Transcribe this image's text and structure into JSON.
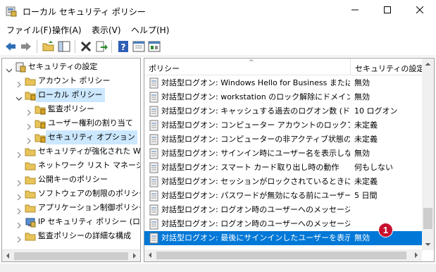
{
  "window": {
    "title": "ローカル セキュリティ ポリシー",
    "icon": "security-policy-icon",
    "controls": [
      "minimize-icon",
      "maximize-icon",
      "close-icon"
    ]
  },
  "menu": [
    {
      "label": "ファイル(F)"
    },
    {
      "label": "操作(A)"
    },
    {
      "label": "表示(V)"
    },
    {
      "label": "ヘルプ(H)"
    }
  ],
  "toolbar": [
    "back-arrow-icon",
    "forward-arrow-icon",
    "up-folder-icon",
    "show-hide-tree-icon",
    "delete-icon",
    "export-icon",
    "help-icon",
    "view-icon",
    "refresh-icon"
  ],
  "tree": [
    {
      "label": "セキュリティの設定",
      "level": 0,
      "expanded": true,
      "icon": "security-settings-icon"
    },
    {
      "label": "アカウント ポリシー",
      "level": 1,
      "expanded": false,
      "icon": "folder-icon"
    },
    {
      "label": "ローカル ポリシー",
      "level": 1,
      "expanded": true,
      "icon": "folder-open-icon",
      "selected": true
    },
    {
      "label": "監査ポリシー",
      "level": 2,
      "expanded": false,
      "icon": "folder-icon"
    },
    {
      "label": "ユーザー権利の割り当て",
      "level": 2,
      "expanded": false,
      "icon": "folder-icon"
    },
    {
      "label": "セキュリティ オプション",
      "level": 2,
      "expanded": false,
      "icon": "folder-icon",
      "highlight": true
    },
    {
      "label": "セキュリティが強化された Windo",
      "level": 1,
      "expanded": false,
      "icon": "folder-icon"
    },
    {
      "label": "ネットワーク リスト マネージャー ポ",
      "level": 1,
      "expanded": null,
      "icon": "folder-icon"
    },
    {
      "label": "公開キーのポリシー",
      "level": 1,
      "expanded": false,
      "icon": "folder-icon"
    },
    {
      "label": "ソフトウェアの制限のポリシー",
      "level": 1,
      "expanded": false,
      "icon": "folder-icon"
    },
    {
      "label": "アプリケーション制御ポリシー",
      "level": 1,
      "expanded": false,
      "icon": "folder-icon"
    },
    {
      "label": "IP セキュリティ ポリシー (ローカル :",
      "level": 1,
      "expanded": false,
      "icon": "ip-security-icon"
    },
    {
      "label": "監査ポリシーの詳細な構成",
      "level": 1,
      "expanded": false,
      "icon": "folder-icon"
    }
  ],
  "list": {
    "columns": [
      "ポリシー",
      "セキュリティの設定"
    ],
    "sort_indicator": "^",
    "rows": [
      {
        "policy": "対話型ログオン: Windows Hello for Business または...",
        "setting": "無効"
      },
      {
        "policy": "対話型ログオン: workstation のロック解除にドメイン コ...",
        "setting": "無効"
      },
      {
        "policy": "対話型ログオン: キャッシュする過去のログオン数 (ドメイ...",
        "setting": "10 ログオン"
      },
      {
        "policy": "対話型ログオン: コンピューター アカウントのロックアウトの...",
        "setting": "未定義"
      },
      {
        "policy": "対話型ログオン: コンピューターの非アクティブ状態の上限",
        "setting": "未定義"
      },
      {
        "policy": "対話型ログオン: サインイン時にユーザー名を表示しない",
        "setting": "無効"
      },
      {
        "policy": "対話型ログオン: スマート カード取り出し時の動作",
        "setting": "何もしない"
      },
      {
        "policy": "対話型ログオン: セッションがロックされているときにユーザ...",
        "setting": "未定義"
      },
      {
        "policy": "対話型ログオン: パスワードが無効になる前にユーザーに...",
        "setting": "5 日間"
      },
      {
        "policy": "対話型ログオン: ログオン時のユーザーへのメッセージのタ",
        "setting": ""
      },
      {
        "policy": "対話型ログオン: ログオン時のユーザーへのメッセージのテ",
        "setting": ""
      },
      {
        "policy": "対話型ログオン: 最後にサインインしたユーザーを表示し",
        "setting": "無効",
        "selected": true
      }
    ]
  },
  "annotation": {
    "badge_text": "1"
  },
  "colors": {
    "selection": "#0078d7",
    "tree_selection": "#cce8ff",
    "badge": "#c8102e"
  }
}
